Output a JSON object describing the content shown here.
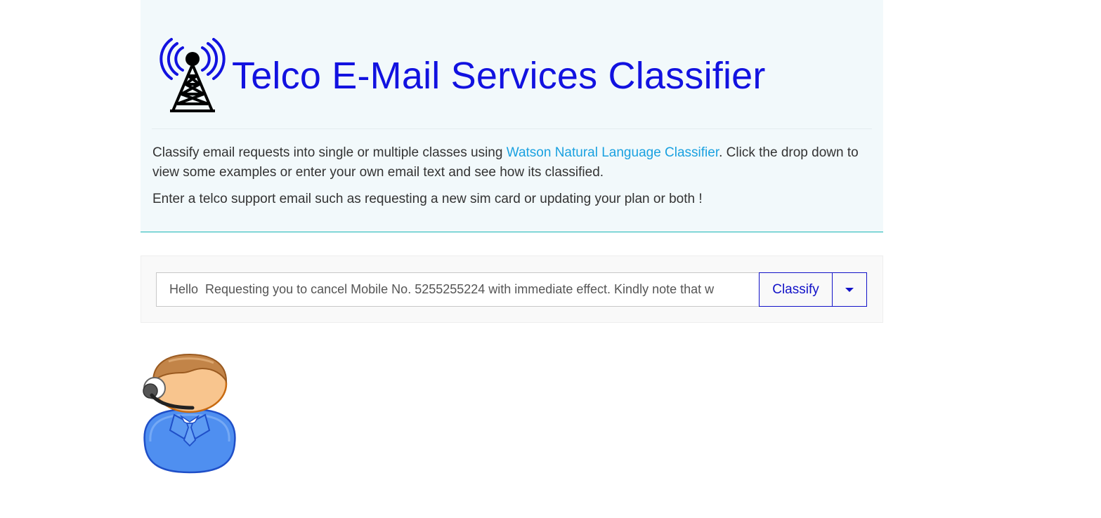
{
  "header": {
    "title": "Telco E-Mail Services Classifier",
    "logo_icon": "radio-tower-icon"
  },
  "description": {
    "intro_before_link": "Classify email requests into single or multiple classes using ",
    "link_text": "Watson Natural Language Classifier",
    "intro_after_link": ". Click the drop down to view some examples or enter your own email text and see how its classified.",
    "prompt": "Enter a telco support email such as requesting a new sim card or updating your plan or both !"
  },
  "form": {
    "email_value": "Hello  Requesting you to cancel Mobile No. 5255255224 with immediate effect. Kindly note that w",
    "classify_label": "Classify",
    "dropdown_icon": "caret-down-icon"
  },
  "avatar": {
    "icon": "support-agent-headset-icon"
  },
  "colors": {
    "title": "#1212e0",
    "link": "#1aa1e0",
    "header_bg": "#f2f9fb",
    "header_border": "#19b6b6",
    "button": "#1212c8"
  }
}
